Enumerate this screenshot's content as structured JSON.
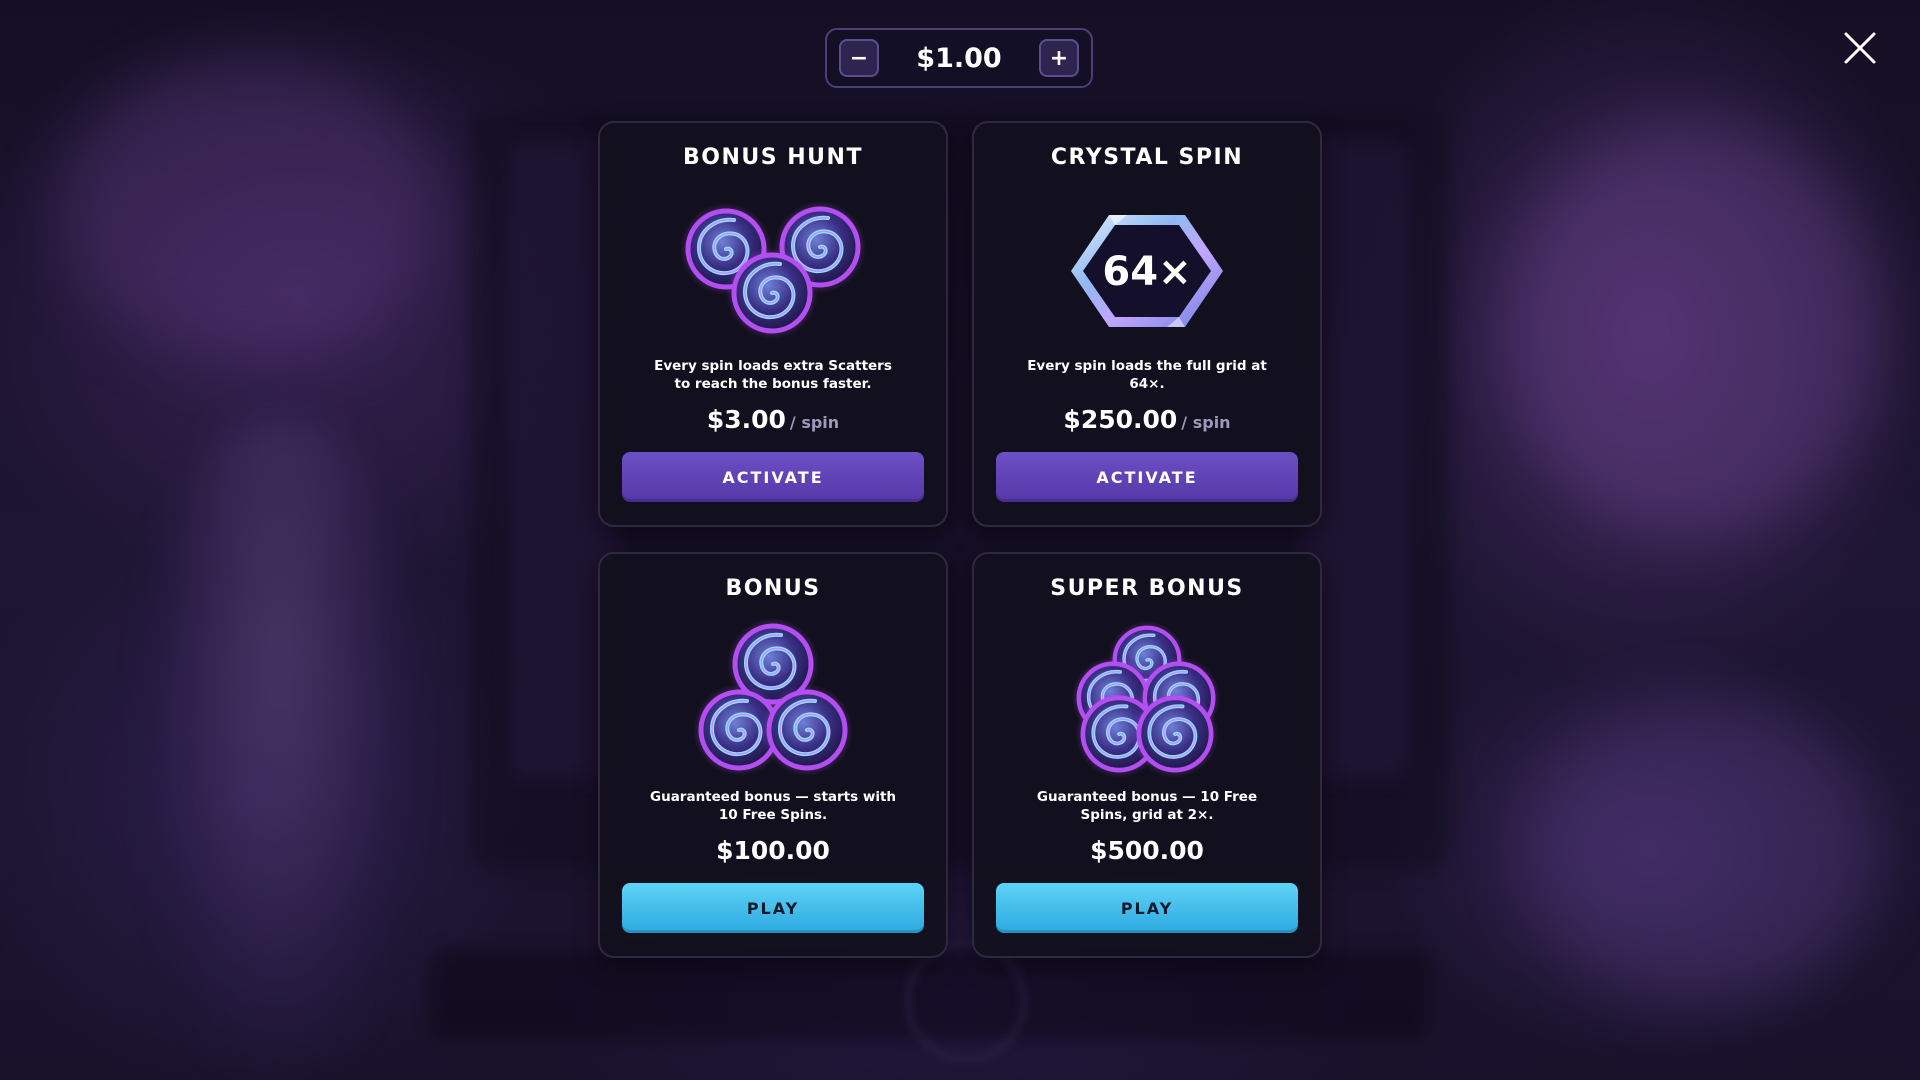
{
  "bet": {
    "decrease_label": "−",
    "amount": "$1.00",
    "increase_label": "+",
    "decrease_icon": "minus-icon",
    "increase_icon": "plus-icon"
  },
  "close_icon": "close-icon",
  "colors": {
    "activate_button": "#5e40b3",
    "play_button": "#3cb8ea",
    "card_background": "#141220",
    "price_unit": "#9f98b8"
  },
  "cards": [
    {
      "title": "BONUS HUNT",
      "icon": "three-scatter-swirls-icon",
      "description": "Every spin loads extra Scatters to reach the bonus faster.",
      "price": "$3.00",
      "price_unit": "/ spin",
      "button_label": "ACTIVATE"
    },
    {
      "title": "CRYSTAL SPIN",
      "icon": "crystal-hexagon-icon",
      "badge": "64×",
      "description": "Every spin loads the full grid at 64×.",
      "price": "$250.00",
      "price_unit": "/ spin",
      "button_label": "ACTIVATE"
    },
    {
      "title": "BONUS",
      "icon": "three-scatter-swirls-stacked-icon",
      "description": "Guaranteed bonus — starts with 10 Free Spins.",
      "price": "$100.00",
      "button_label": "PLAY"
    },
    {
      "title": "SUPER BONUS",
      "icon": "five-scatter-swirls-icon",
      "description": "Guaranteed bonus — 10 Free Spins, grid at 2×.",
      "price": "$500.00",
      "button_label": "PLAY"
    }
  ]
}
